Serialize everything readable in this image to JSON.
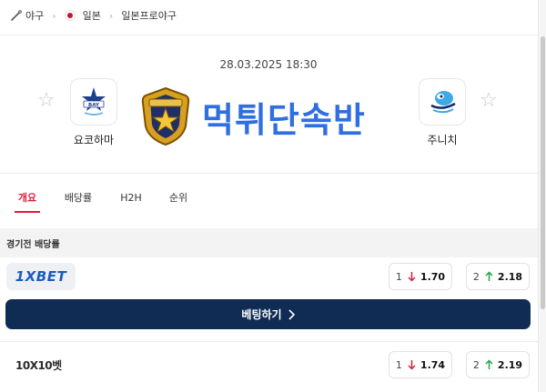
{
  "breadcrumb": {
    "sport_icon": "baseball-bat-icon",
    "sport": "야구",
    "country": "일본",
    "country_flag": "japan-flag-icon",
    "league": "일본프로야구"
  },
  "match": {
    "datetime": "28.03.2025 18:30",
    "home": {
      "name": "요코하마",
      "logo": "yokohama-baystars-logo"
    },
    "away": {
      "name": "주니치",
      "logo": "chunichi-dragons-logo"
    }
  },
  "watermark": {
    "text": "먹튀단속반",
    "emblem": "police-badge-icon"
  },
  "tabs": [
    {
      "label": "개요",
      "active": true
    },
    {
      "label": "배당률",
      "active": false
    },
    {
      "label": "H2H",
      "active": false
    },
    {
      "label": "순위",
      "active": false
    }
  ],
  "odds_section": {
    "title": "경기전 배당률"
  },
  "bookmakers": [
    {
      "name": "1XBET",
      "odds": [
        {
          "label": "1",
          "direction": "down",
          "value": "1.70"
        },
        {
          "label": "2",
          "direction": "up",
          "value": "2.18"
        }
      ]
    },
    {
      "name": "10X10벳",
      "odds": [
        {
          "label": "1",
          "direction": "down",
          "value": "1.74"
        },
        {
          "label": "2",
          "direction": "up",
          "value": "2.19"
        }
      ]
    }
  ],
  "bet_button": {
    "label": "베팅하기"
  },
  "colors": {
    "accent": "#d81f3f",
    "button_bg": "#112c54",
    "arrow_down": "#d81f3f",
    "arrow_up": "#1aa64a",
    "watermark_text": "#2f6fe0",
    "onexbet_blue": "#1a5cbf"
  }
}
